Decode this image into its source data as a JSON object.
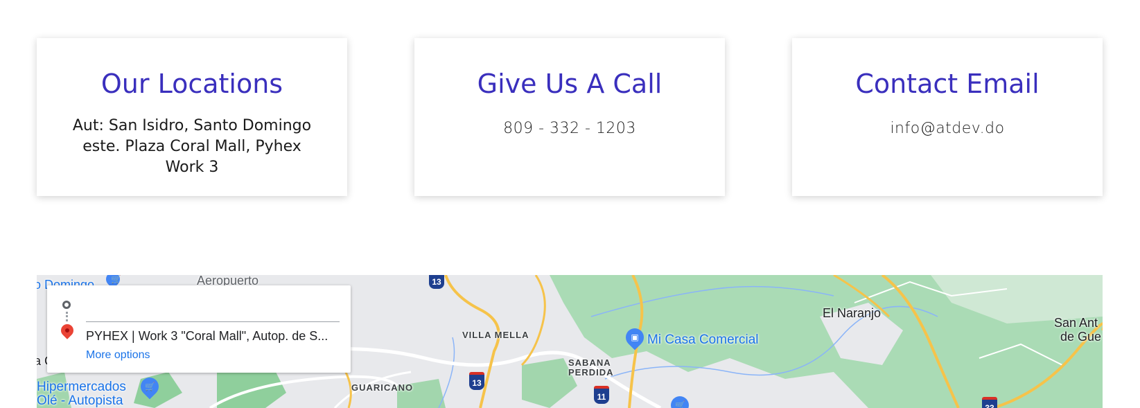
{
  "cards": [
    {
      "title": "Our Locations",
      "text": "Aut: San Isidro, Santo Domingo este. Plaza Coral Mall, Pyhex Work 3"
    },
    {
      "title": "Give Us A Call",
      "text": "809 - 332 - 1203"
    },
    {
      "title": "Contact Email",
      "text": "info@atdev.do"
    }
  ],
  "map": {
    "labels": {
      "aeropuerto": "Aeropuerto",
      "domingo": "o Domingo",
      "villa_mella": "VILLA MELLA",
      "sabana_perdida_1": "SABANA",
      "sabana_perdida_2": "PERDIDA",
      "guaricano": "GUARICANO",
      "el_naranjo": "El Naranjo",
      "san_ant_1": "San Ant",
      "san_ant_2": "de Gue",
      "mi_casa": "Mi Casa Comercial",
      "hiper_1": "Hipermercados",
      "hiper_2": "Olé - Autopista",
      "a_c": "a C"
    },
    "route_shields": [
      "13",
      "13",
      "11",
      "33"
    ]
  },
  "directions": {
    "destination": "PYHEX | Work 3 \"Coral Mall\", Autop. de S...",
    "more_options": "More options"
  }
}
